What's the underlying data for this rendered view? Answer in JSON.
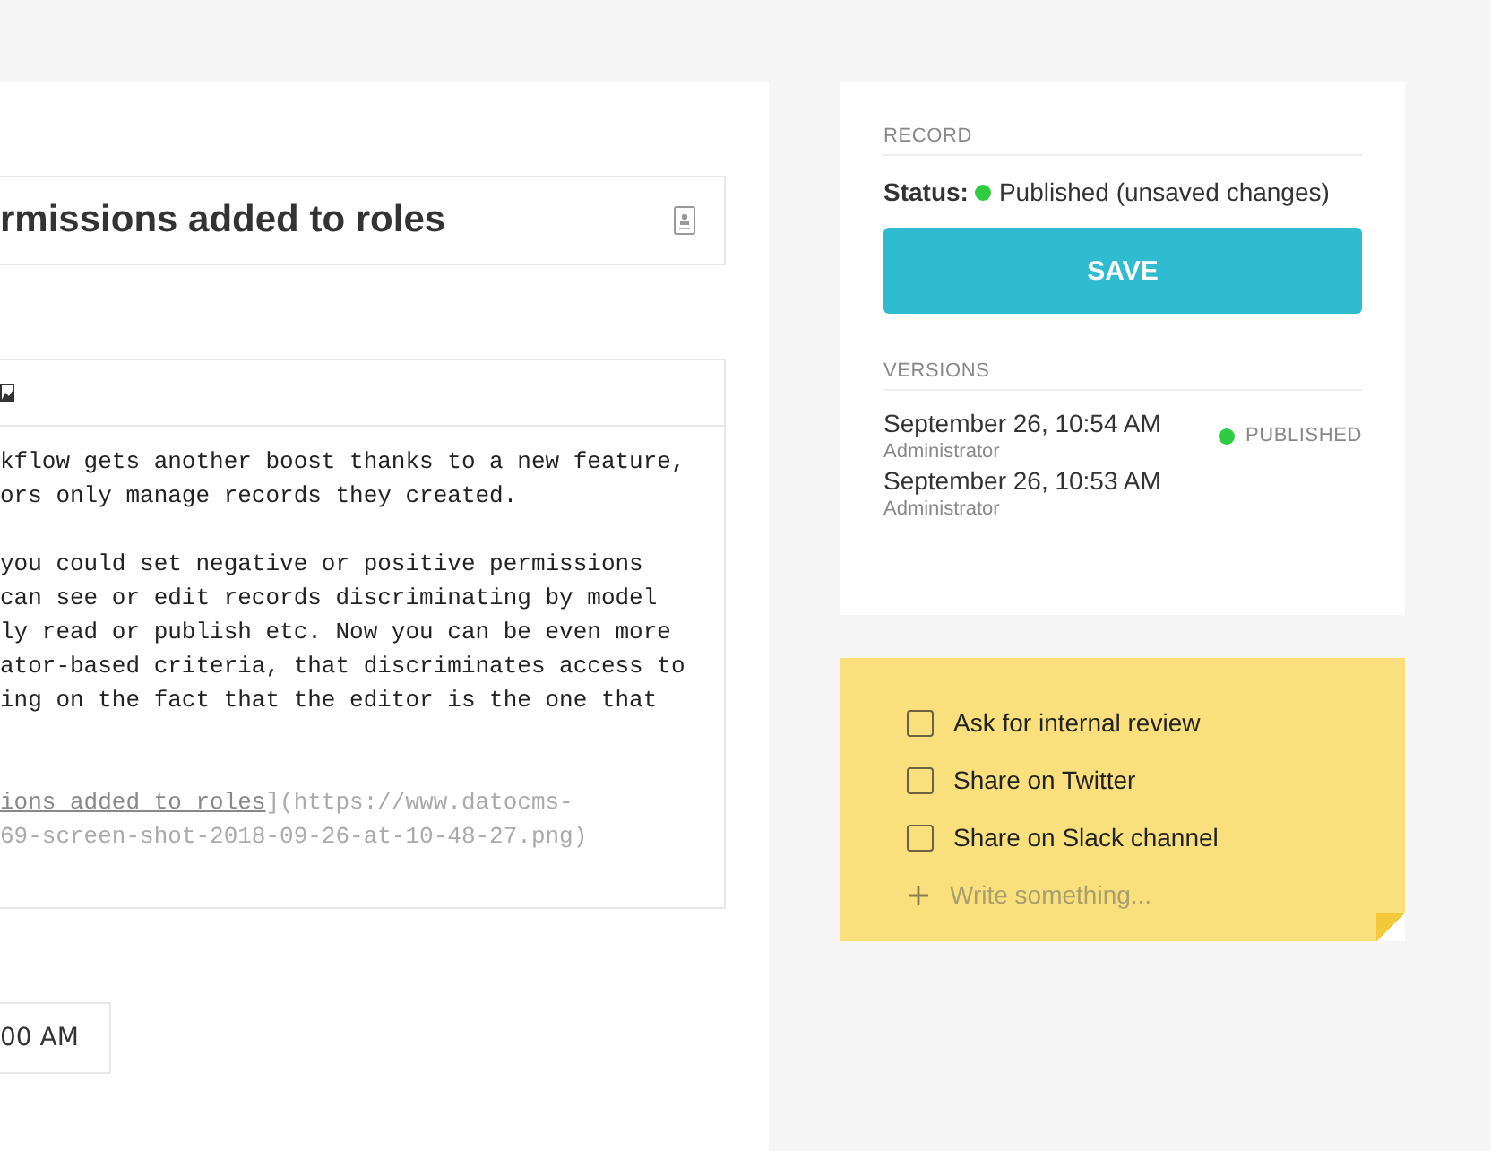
{
  "editor": {
    "title_field": {
      "value": "rmissions added to roles"
    },
    "paragraphs": [
      [
        "kflow gets another boost thanks to a new feature,",
        "ors only manage records they created."
      ],
      [
        "you could set negative or positive permissions",
        "can see or edit records discriminating by model",
        "ly read or publish etc. Now you can be even more",
        "ator-based criteria, that discriminates access to",
        "ing on the fact that the editor is the one that"
      ]
    ],
    "link": {
      "label": "ions added to roles",
      "rest": "](https://www.datocms-",
      "next_line": "69-screen-shot-2018-09-26-at-10-48-27.png)"
    },
    "date_field": {
      "value": "00 AM"
    }
  },
  "record": {
    "heading": "RECORD",
    "status_label": "Status:",
    "status_text": "Published (unsaved changes)",
    "save_button": "SAVE",
    "versions_heading": "VERSIONS",
    "versions": [
      {
        "date": "September 26, 10:54 AM",
        "author": "Administrator",
        "badge": "PUBLISHED"
      },
      {
        "date": "September 26, 10:53 AM",
        "author": "Administrator"
      }
    ]
  },
  "note": {
    "tasks": [
      {
        "label": "Ask for internal review",
        "checked": false
      },
      {
        "label": "Share on Twitter",
        "checked": false
      },
      {
        "label": "Share on Slack channel",
        "checked": false
      }
    ],
    "placeholder": "Write something..."
  }
}
